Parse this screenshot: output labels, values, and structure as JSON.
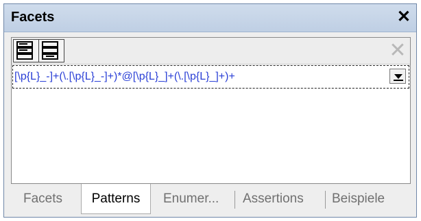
{
  "window": {
    "title": "Facets",
    "close_symbol": "✕"
  },
  "toolbar": {
    "delete_symbol": "✕"
  },
  "patterns": [
    {
      "value": "[\\p{L}_-]+(\\.[\\p{L}_-]+)*@[\\p{L}_]+(\\.[\\p{L}_]+)+"
    }
  ],
  "tabs": [
    {
      "label": "Facets",
      "active": false
    },
    {
      "label": "Patterns",
      "active": true
    },
    {
      "label": "Enumer...",
      "active": false
    },
    {
      "label": "Assertions",
      "active": false
    },
    {
      "label": "Beispiele",
      "active": false
    }
  ],
  "colors": {
    "pattern_text": "#2a3fd6",
    "titlebar": "#c7d6ea"
  }
}
